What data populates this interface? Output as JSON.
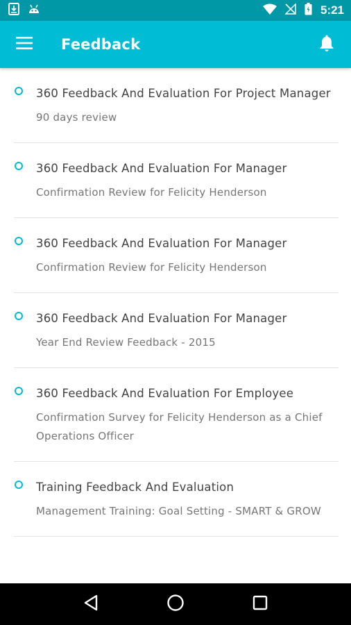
{
  "status_bar": {
    "time": "5:21"
  },
  "app_bar": {
    "title": "Feedback"
  },
  "feedback_items": [
    {
      "title": "360 Feedback And Evaluation For Project Manager",
      "subtitle": "90 days review"
    },
    {
      "title": "360 Feedback And Evaluation For Manager",
      "subtitle": "Confirmation Review for Felicity Henderson"
    },
    {
      "title": "360 Feedback And Evaluation For Manager",
      "subtitle": "Confirmation Review for Felicity Henderson"
    },
    {
      "title": "360 Feedback And Evaluation For Manager",
      "subtitle": "Year End Review Feedback - 2015"
    },
    {
      "title": "360 Feedback And Evaluation For Employee",
      "subtitle": "Confirmation Survey for Felicity Henderson as a Chief Operations Officer"
    },
    {
      "title": "Training Feedback And Evaluation",
      "subtitle": "Management Training: Goal Setting - SMART & GROW"
    }
  ],
  "icons": {
    "status_left": [
      "download-notification-icon",
      "android-icon"
    ],
    "status_right": [
      "wifi-icon",
      "no-signal-icon",
      "battery-icon"
    ],
    "app_bar": [
      "menu-icon",
      "bell-icon"
    ],
    "nav": [
      "back-icon",
      "home-icon",
      "recents-icon"
    ]
  },
  "colors": {
    "primary": "#00bcd4",
    "primary_dark": "#0097a7",
    "bullet": "#00bcd4"
  }
}
